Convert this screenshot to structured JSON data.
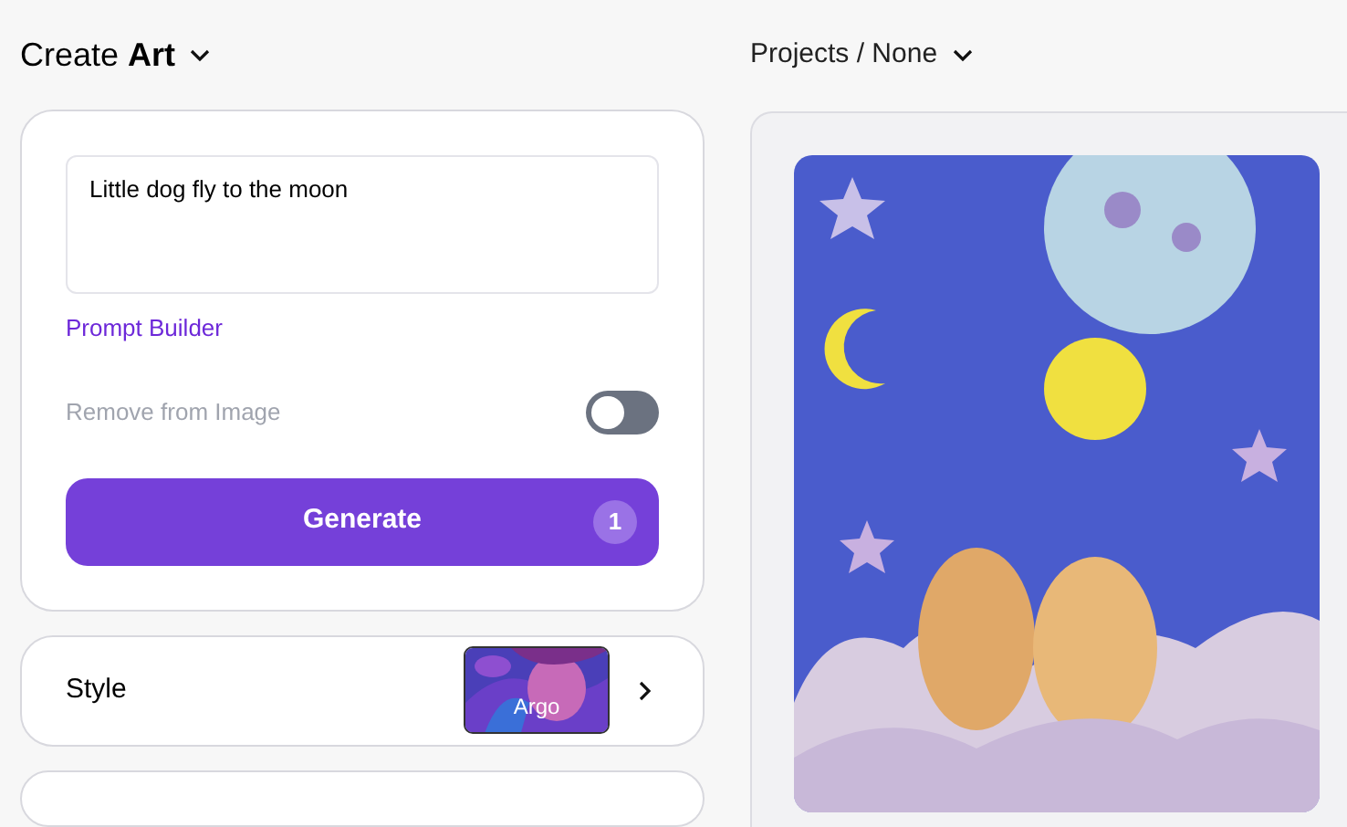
{
  "header": {
    "title": "Create **Art**"
  },
  "prompt": {
    "value": "Little dog fly to the moon"
  },
  "prompt_builder": {
    "label": "Prompt Builder"
  },
  "remove_from_image": {
    "label": "Remove from Image",
    "on": false
  },
  "generate": {
    "label": "Generate",
    "count": "1"
  },
  "style": {
    "label": "Style",
    "selection": "Argo"
  },
  "breadcrumb": {
    "label": "Projects / None"
  }
}
